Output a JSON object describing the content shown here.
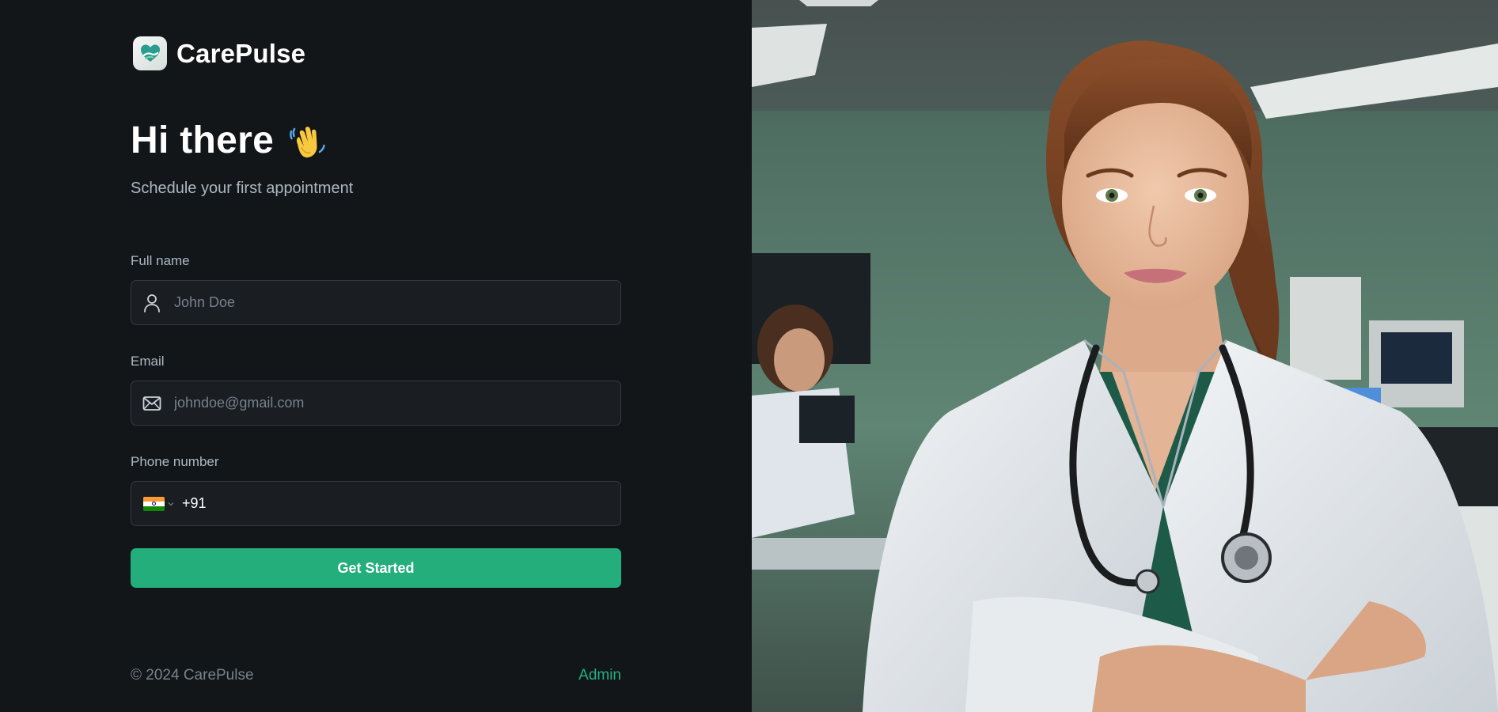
{
  "brand": {
    "name": "CarePulse",
    "logo_icon": "heart-hand-icon",
    "accent_color": "#24ae7c",
    "background_color": "#131619"
  },
  "hero": {
    "title": "Hi there",
    "emoji_icon": "waving-hand-icon",
    "subtitle": "Schedule your first appointment"
  },
  "form": {
    "full_name": {
      "label": "Full name",
      "placeholder": "John Doe",
      "value": "",
      "icon": "user-icon"
    },
    "email": {
      "label": "Email",
      "placeholder": "johndoe@gmail.com",
      "value": "",
      "icon": "mail-icon"
    },
    "phone": {
      "label": "Phone number",
      "country_flag_icon": "india-flag-icon",
      "value": "+91"
    },
    "submit_label": "Get Started"
  },
  "footer": {
    "copyright": "© 2024 CarePulse",
    "admin_link": "Admin"
  },
  "side_image": {
    "subject": "doctor-photo"
  }
}
